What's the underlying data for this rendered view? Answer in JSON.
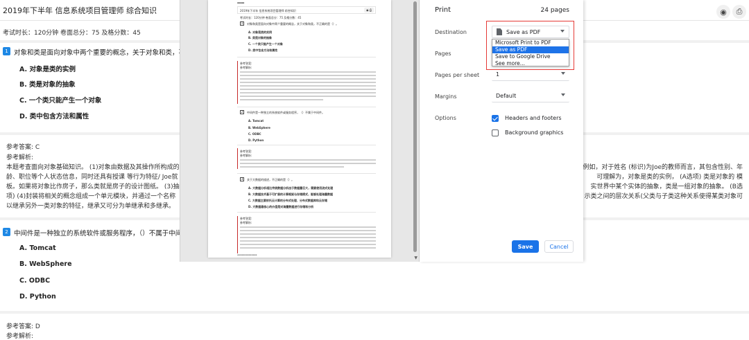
{
  "page": {
    "title": "2019年下半年 信息系统项目管理师 综合知识",
    "meta": "考试时长：120分钟 卷面总分：75 及格分数：45",
    "eye_icon": "eye-icon",
    "print_icon": "printer-icon"
  },
  "q1": {
    "num": "1",
    "text": "对象和类是面向对象中两个重要的概念，关于对象和类，不正",
    "options": [
      "A. 对象是类的实例",
      "B. 类是对象的抽象",
      "C. 一个类只能产生一个对象",
      "D. 类中包含方法和属性"
    ],
    "answer": "参考答案: C",
    "analysis_label": "参考解析:",
    "exp": [
      {
        "left": "本题考查面向对象基础知识。 (1)对象由数据及其操作所构成的",
        "right": "例如，对于姓名 (标识)为Joe的教师而言，其包含性别、年"
      },
      {
        "left": "龄、职位等个人状态信息，同时还具有授课 等行为特征/ Joe就",
        "right": "可理解为，对象是类的实例， (A选项) 类是对象的 模"
      },
      {
        "left": "板。如果将对象比作房子，那么类就是房子的设计图纸。 (3)抽",
        "right": "实世界中某个实体的抽象，类是一组对象的抽象。 (B选"
      },
      {
        "left": "项) (4)封装将相关的概念组成一个单元模块，并通过一个名称",
        "right": "示类之间的层次关系(父类与子类这种关系使得某类对象可"
      },
      {
        "left": "以继承另外一类对象的特征，继承又可分为单继承和多继承。",
        "right": ""
      }
    ]
  },
  "q2": {
    "num": "2",
    "text": "中间件是一种独立的系统软件或服务程序，（）不属于中间",
    "options": [
      "A. Tomcat",
      "B. WebSphere",
      "C. ODBC",
      "D. Python"
    ],
    "answer": "参考答案: D",
    "analysis_label": "参考解析:"
  },
  "preview": {
    "page_title": "2019年下半年 信息系统项目管理师 综合知识",
    "meta": "考试时长：120分钟 卷面总分：75 及格分数：45",
    "q1_text": "对象和类是面向对象中两个重要的概念，关于对象和类，不正确的是（）。",
    "q1_options": [
      "A. 对象是类的实例",
      "B. 类是对象的抽象",
      "C. 一个类只能产生一个对象",
      "D. 类中包含方法和属性"
    ],
    "q2_text": "中间件是一种独立的系统软件或服务程序，（）不属于中间件。",
    "q2_options": [
      "A. Tomcat",
      "B. WebSphere",
      "C. ODBC",
      "D. Python"
    ],
    "q3_text": "关于大数据的描述，不正确的是（）。",
    "q3_options": [
      "A. 大数据分析相比传统数据分析由于数据量巨大，需要使用流式处理",
      "B. 大数据技术基于可扩展的计算框架与存储模式，能够处理海量数据",
      "C. 大数据主要依托云计算的分布式处理、分布式数据库和云存储",
      "D. 大数据最核心的价值是对海量数据进行存储和分析"
    ],
    "ans_label": "参考答案:",
    "exp_label": "参考解析:"
  },
  "settings": {
    "title": "Print",
    "pages_count": "24 pages",
    "destination_label": "Destination",
    "destination_value": "Save as PDF",
    "destination_options": [
      "Microsoft Print to PDF",
      "Save as PDF",
      "Save to Google Drive",
      "See more..."
    ],
    "pages_label": "Pages",
    "pps_label": "Pages per sheet",
    "pps_value": "1",
    "margins_label": "Margins",
    "margins_value": "Default",
    "options_label": "Options",
    "headers_footers": "Headers and footers",
    "background_graphics": "Background graphics",
    "headers_checked": true,
    "background_checked": false,
    "save_label": "Save",
    "cancel_label": "Cancel",
    "accent_color": "#1a73e8",
    "highlight_color": "#e53935"
  }
}
